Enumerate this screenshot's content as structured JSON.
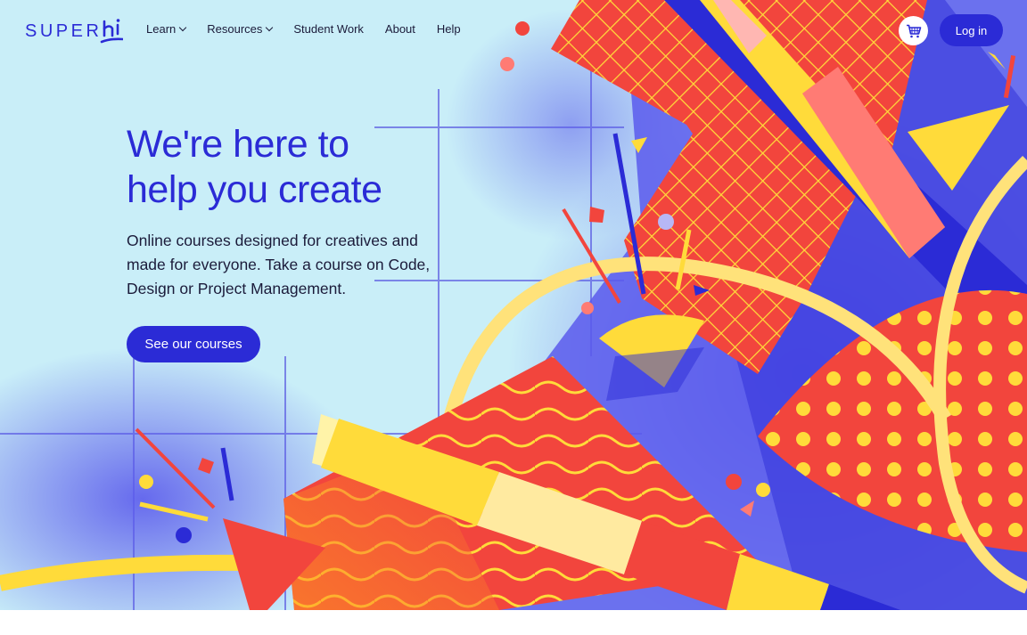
{
  "brand": {
    "logo_text": "SUPERHI"
  },
  "nav": {
    "items": [
      {
        "label": "Learn",
        "has_dropdown": true
      },
      {
        "label": "Resources",
        "has_dropdown": true
      },
      {
        "label": "Student Work",
        "has_dropdown": false
      },
      {
        "label": "About",
        "has_dropdown": false
      },
      {
        "label": "Help",
        "has_dropdown": false
      }
    ],
    "cart_icon": "shopping-cart-icon",
    "login_label": "Log in"
  },
  "hero": {
    "headline_line1": "We're here to",
    "headline_line2": "help you create",
    "subcopy": "Online courses designed for creatives and made for everyone. Take a course on Code, Design or Project Management.",
    "cta_label": "See our courses"
  },
  "colors": {
    "accent": "#2b2bd6",
    "background": "#c9eef8",
    "yellow": "#ffdb3a",
    "red": "#f2453d",
    "pink": "#ff7b74",
    "text": "#1b1b3a"
  }
}
